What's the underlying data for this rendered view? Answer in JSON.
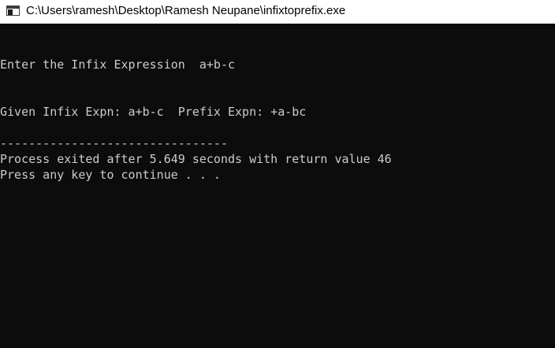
{
  "window": {
    "title": "C:\\Users\\ramesh\\Desktop\\Ramesh Neupane\\infixtoprefix.exe"
  },
  "console": {
    "prompt_line": "Enter the Infix Expression  a+b-c",
    "result_line": "Given Infix Expn: a+b-c  Prefix Expn: +a-bc",
    "separator_line": "--------------------------------",
    "exit_line": "Process exited after 5.649 seconds with return value 46",
    "continue_line": "Press any key to continue . . ."
  },
  "colors": {
    "console_background": "#0c0c0c",
    "console_text": "#cccccc",
    "titlebar_background": "#ffffff"
  },
  "icons": {
    "app_icon": "console-window-icon"
  }
}
